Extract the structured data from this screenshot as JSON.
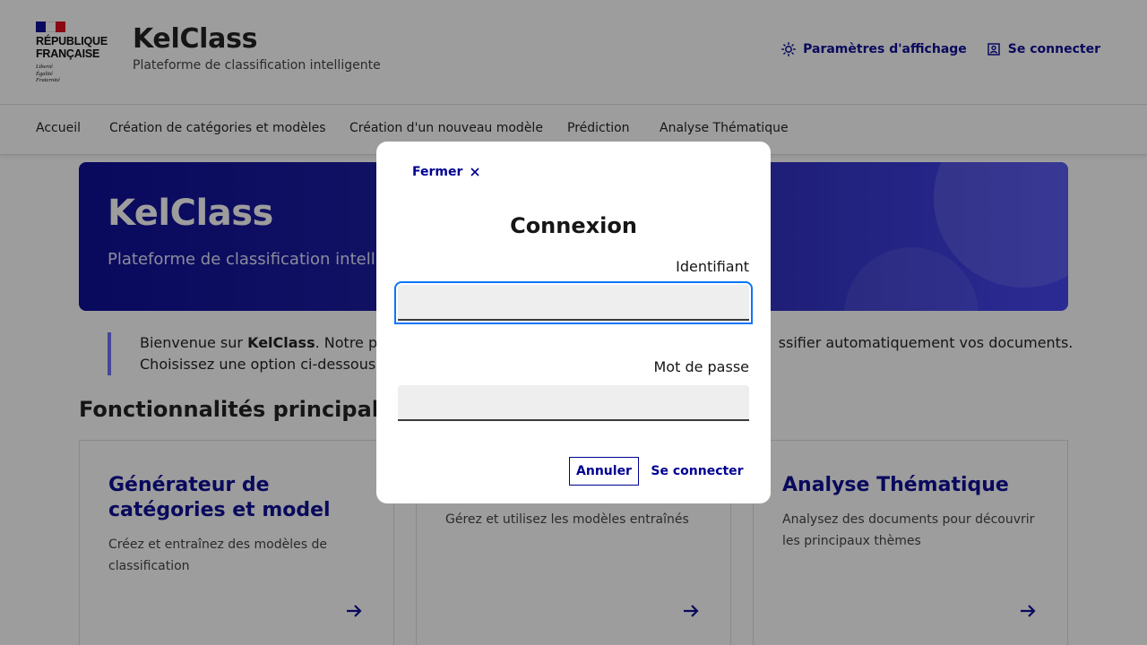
{
  "header": {
    "republic_name_line1": "RÉPUBLIQUE",
    "republic_name_line2": "FRANÇAISE",
    "motto": [
      "Liberté",
      "Égalité",
      "Fraternité"
    ],
    "site_title": "KelClass",
    "site_tagline": "Plateforme de classification intelligente",
    "display_settings_label": "Paramètres d'affichage",
    "login_label": "Se connecter"
  },
  "nav": {
    "items": [
      {
        "label": "Accueil"
      },
      {
        "label": "Création de catégories et modèles"
      },
      {
        "label": "Création d'un nouveau modèle"
      },
      {
        "label": "Prédiction"
      },
      {
        "label": "Analyse Thématique"
      }
    ]
  },
  "hero": {
    "title": "KelClass",
    "subtitle": "Plateforme de classification intellig"
  },
  "intro": {
    "line1_prefix": "Bienvenue sur ",
    "line1_bold": "KelClass",
    "line1_visible_start": ". Notre plat",
    "line1_visible_end": "ssifier automatiquement vos documents.",
    "line2_visible": "Choisissez une option ci-dessous p"
  },
  "section_title": "Fonctionnalités principales",
  "cards": [
    {
      "title": "Générateur de catégories et model",
      "description": "Créez et entraînez des modèles de classification"
    },
    {
      "title": "",
      "description": "Gérez et utilisez les modèles entraînés"
    },
    {
      "title": "Analyse Thématique",
      "description": "Analysez des documents pour découvrir les principaux thèmes"
    }
  ],
  "modal": {
    "close_label": "Fermer",
    "title": "Connexion",
    "username_label": "Identifiant",
    "username_value": "",
    "password_label": "Mot de passe",
    "password_value": "",
    "cancel_label": "Annuler",
    "submit_label": "Se connecter"
  },
  "colors": {
    "brand_blue": "#000091",
    "focus_ring": "#0a76f6",
    "flag_blue": "#000091",
    "flag_red": "#e1000f"
  }
}
